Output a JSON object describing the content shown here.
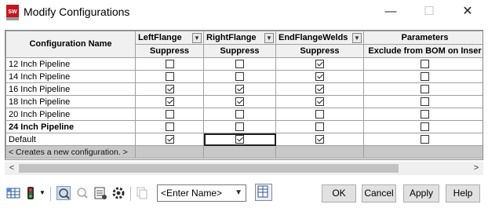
{
  "window": {
    "title": "Modify Configurations",
    "app_icon": "sw-logo-icon",
    "minimize_glyph": "—",
    "maximize_glyph": "☐",
    "close_glyph": "✕"
  },
  "grid": {
    "header_config_name": "Configuration Name",
    "columns": [
      {
        "name": "LeftFlange",
        "sub": "Suppress"
      },
      {
        "name": "RightFlange",
        "sub": "Suppress"
      },
      {
        "name": "EndFlangeWelds",
        "sub": "Suppress"
      },
      {
        "name": "Parameters",
        "sub": "Exclude from BOM on Inser"
      }
    ],
    "rows": [
      {
        "name": "12 Inch Pipeline",
        "bold": false,
        "values": [
          false,
          false,
          true,
          false
        ]
      },
      {
        "name": "14 Inch Pipeline",
        "bold": false,
        "values": [
          false,
          false,
          true,
          false
        ]
      },
      {
        "name": "16 Inch Pipeline",
        "bold": false,
        "values": [
          true,
          true,
          true,
          false
        ]
      },
      {
        "name": "18 Inch Pipeline",
        "bold": false,
        "values": [
          true,
          true,
          true,
          false
        ]
      },
      {
        "name": "20 Inch Pipeline",
        "bold": false,
        "values": [
          false,
          false,
          false,
          false
        ]
      },
      {
        "name": "24 Inch Pipeline",
        "bold": true,
        "values": [
          false,
          false,
          false,
          false
        ]
      },
      {
        "name": "Default",
        "bold": false,
        "values": [
          true,
          true,
          true,
          false
        ]
      }
    ],
    "new_config_label": "< Creates a new configuration. >"
  },
  "toolbar": {
    "name_select_value": "<Enter Name>",
    "ok_label": "OK",
    "cancel_label": "Cancel",
    "apply_label": "Apply",
    "help_label": "Help"
  }
}
